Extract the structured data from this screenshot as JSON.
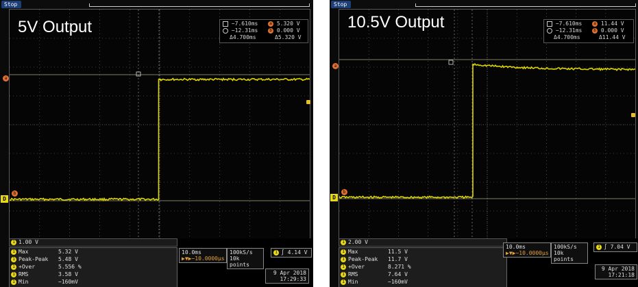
{
  "colors": {
    "trace": "#e8e000",
    "graticule": "#c8c8c8",
    "marker": "#e07030",
    "tab": "#1d3f78"
  },
  "icons": {
    "channel": "channel-1-badge",
    "cursor_a": "square-icon",
    "cursor_b": "circle-icon",
    "ground": "ground-marker-icon",
    "trigger": "trigger-marker-icon"
  },
  "panels": [
    {
      "title": "5V Output",
      "run_state": "Stop",
      "cursors": {
        "a_time": "−7.610ms",
        "a_value": "5.320 V",
        "b_time": "−12.31ms",
        "b_value": "0.000 V",
        "delta_time": "Δ4.700ms",
        "delta_value": "Δ5.320 V",
        "a_marker": "a",
        "b_marker": "b"
      },
      "ground_marker": "D",
      "channel_scale": "1.00 V",
      "measurements": [
        {
          "name": "Max",
          "value": "5.32 V"
        },
        {
          "name": "Peak-Peak",
          "value": "5.48 V"
        },
        {
          "name": "+Over",
          "value": "5.556 %"
        },
        {
          "name": "RMS",
          "value": "3.58 V"
        },
        {
          "name": "Min",
          "value": "−160mV"
        }
      ],
      "timebase": "10.0ms",
      "trigger_position": "▶▼▶−10.0000µs",
      "sample_rate": "100kS/s",
      "record_length": "10k points",
      "trigger_level": "4.14 V",
      "trigger_channel": "1",
      "trigger_slope": "∫",
      "date": "9 Apr 2018",
      "time": "17:29:33",
      "trace": {
        "low_fraction": 0.0,
        "high_fraction": 1.0,
        "step_time_fraction": 0.5,
        "sag": 0.0
      }
    },
    {
      "title": "10.5V Output",
      "run_state": "Stop",
      "cursors": {
        "a_time": "−7.610ms",
        "a_value": "11.44 V",
        "b_time": "−12.31ms",
        "b_value": "0.000 V",
        "delta_time": "Δ4.700ms",
        "delta_value": "Δ11.44 V",
        "a_marker": "a",
        "b_marker": "b"
      },
      "ground_marker": "D",
      "channel_scale": "2.00 V",
      "measurements": [
        {
          "name": "Max",
          "value": "11.5 V"
        },
        {
          "name": "Peak-Peak",
          "value": "11.7 V"
        },
        {
          "name": "+Over",
          "value": "8.271 %"
        },
        {
          "name": "RMS",
          "value": "7.64 V"
        },
        {
          "name": "Min",
          "value": "−160mV"
        }
      ],
      "timebase": "10.0ms",
      "trigger_position": "▶▼▶−10.0000µs",
      "sample_rate": "100kS/s",
      "record_length": "10k points",
      "trigger_level": "7.04 V",
      "trigger_channel": "1",
      "trigger_slope": "∫",
      "date": "9 Apr 2018",
      "time": "17:21:18",
      "trace": {
        "low_fraction": 0.0,
        "high_fraction": 1.0,
        "step_time_fraction": 0.5,
        "sag": 0.04
      }
    }
  ]
}
